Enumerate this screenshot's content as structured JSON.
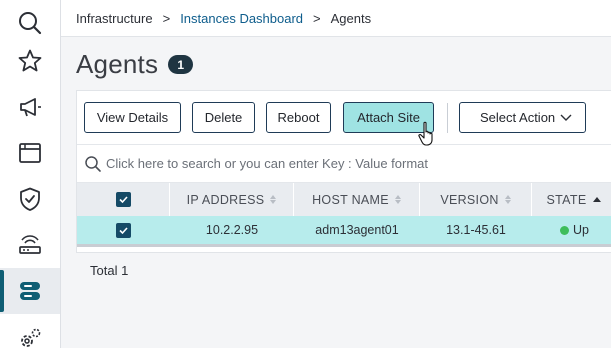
{
  "breadcrumb": {
    "items": [
      "Infrastructure",
      "Instances Dashboard",
      "Agents"
    ],
    "separator": ">"
  },
  "page": {
    "title": "Agents",
    "count": "1"
  },
  "sidebar": {
    "items": [
      {
        "icon": "search-icon"
      },
      {
        "icon": "star-icon"
      },
      {
        "icon": "megaphone-icon"
      },
      {
        "icon": "window-icon"
      },
      {
        "icon": "shield-check-icon"
      },
      {
        "icon": "network-icon"
      },
      {
        "icon": "infrastructure-icon",
        "active": true
      },
      {
        "icon": "settings-icon"
      }
    ]
  },
  "toolbar": {
    "view_details": "View Details",
    "delete": "Delete",
    "reboot": "Reboot",
    "attach_site": "Attach Site",
    "select_action": "Select Action"
  },
  "search": {
    "placeholder": "Click here to search or you can enter Key : Value format"
  },
  "table": {
    "columns": [
      "IP ADDRESS",
      "HOST NAME",
      "VERSION",
      "STATE"
    ],
    "rows": [
      {
        "ip": "10.2.2.95",
        "host": "adm13agent01",
        "version": "13.1-45.61",
        "state": "Up",
        "selected": true
      }
    ]
  },
  "footer": {
    "total": "Total 1"
  },
  "colors": {
    "accent": "#9fe3e3",
    "selected_row": "#b7ecec",
    "status_up": "#3ebd5b",
    "nav_accent": "#0f5e74"
  }
}
